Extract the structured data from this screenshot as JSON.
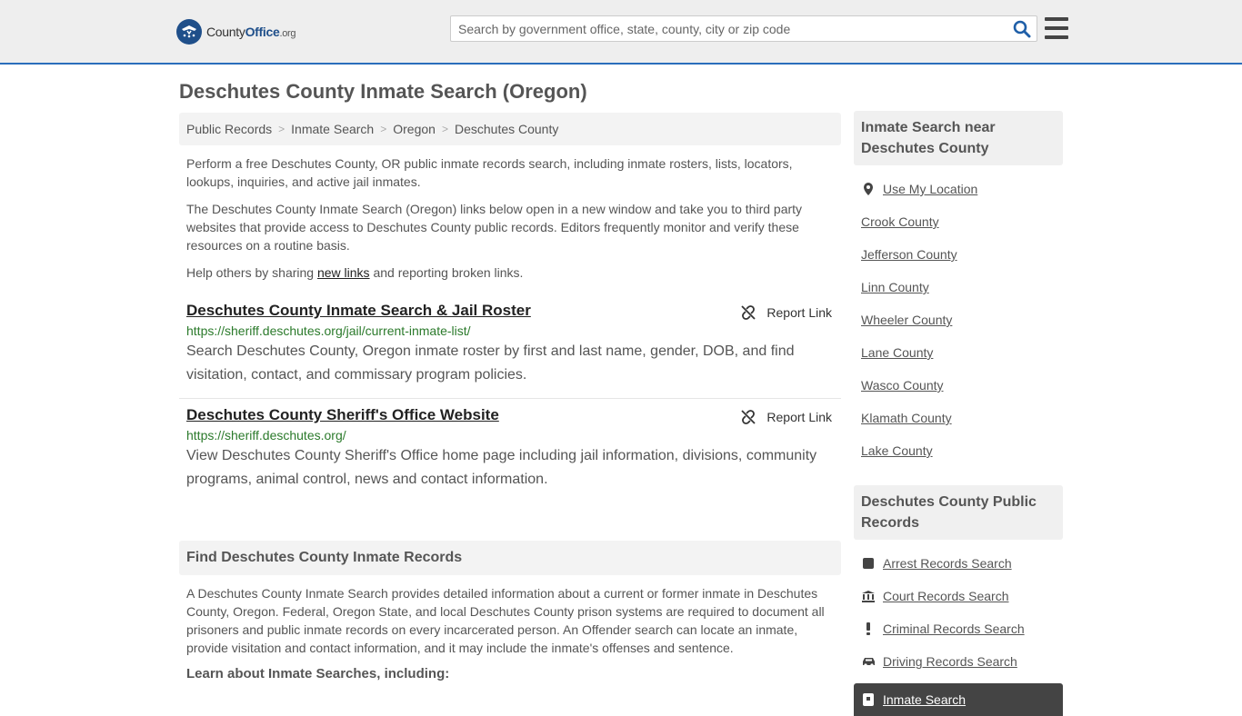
{
  "header": {
    "logo_county": "County",
    "logo_office": "Office",
    "logo_org": ".org",
    "search_placeholder": "Search by government office, state, county, city or zip code"
  },
  "page": {
    "title": "Deschutes County Inmate Search (Oregon)"
  },
  "breadcrumb": [
    "Public Records",
    "Inmate Search",
    "Oregon",
    "Deschutes County"
  ],
  "intro": {
    "p1": "Perform a free Deschutes County, OR public inmate records search, including inmate rosters, lists, locators, lookups, inquiries, and active jail inmates.",
    "p2": "The Deschutes County Inmate Search (Oregon) links below open in a new window and take you to third party websites that provide access to Deschutes County public records. Editors frequently monitor and verify these resources on a routine basis.",
    "p3_before": "Help others by sharing ",
    "p3_link": "new links",
    "p3_after": " and reporting broken links."
  },
  "results": [
    {
      "title": "Deschutes County Inmate Search & Jail Roster",
      "report": "Report Link",
      "url": "https://sheriff.deschutes.org/jail/current-inmate-list/",
      "desc": "Search Deschutes County, Oregon inmate roster by first and last name, gender, DOB, and find visitation, contact, and commissary program policies."
    },
    {
      "title": "Deschutes County Sheriff's Office Website",
      "report": "Report Link",
      "url": "https://sheriff.deschutes.org/",
      "desc": "View Deschutes County Sheriff's Office home page including jail information, divisions, community programs, animal control, news and contact information."
    }
  ],
  "find": {
    "heading": "Find Deschutes County Inmate Records",
    "body": "A Deschutes County Inmate Search provides detailed information about a current or former inmate in Deschutes County, Oregon. Federal, Oregon State, and local Deschutes County prison systems are required to document all prisoners and public inmate records on every incarcerated person. An Offender search can locate an inmate, provide visitation and contact information, and it may include the inmate's offenses and sentence.",
    "learn": "Learn about Inmate Searches, including:"
  },
  "sidebar": {
    "near_heading": "Inmate Search near Deschutes County",
    "near_items": [
      "Use My Location",
      "Crook County",
      "Jefferson County",
      "Linn County",
      "Wheeler County",
      "Lane County",
      "Wasco County",
      "Klamath County",
      "Lake County"
    ],
    "records_heading": "Deschutes County Public Records",
    "records_items": [
      "Arrest Records Search",
      "Court Records Search",
      "Criminal Records Search",
      "Driving Records Search",
      "Inmate Search"
    ]
  },
  "colors": {
    "accent": "#2a6ebb",
    "url_green": "#2b7a2b",
    "active_bg": "#444444"
  }
}
